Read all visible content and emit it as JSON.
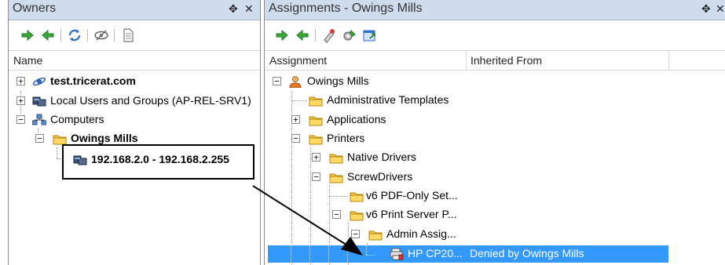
{
  "owners_pane": {
    "title": "Owners",
    "pin": "✥",
    "close": "✕",
    "column_name": "Name",
    "tree": {
      "test_tricerat": "test.tricerat.com",
      "local_users": "Local Users and Groups (AP-REL-SRV1)",
      "computers": "Computers",
      "owings_mills": "Owings Mills",
      "ip_range": "192.168.2.0 - 192.168.2.255"
    }
  },
  "assignments_pane": {
    "title": "Assignments - Owings Mills",
    "pin": "✥",
    "close": "✕",
    "columns": {
      "assignment": "Assignment",
      "inherited_from": "Inherited From"
    },
    "tree": {
      "owings_mills": "Owings Mills",
      "admin_templates": "Administrative Templates",
      "applications": "Applications",
      "printers": "Printers",
      "native_drivers": "Native Drivers",
      "screwdrivers": "ScrewDrivers",
      "v6_pdf": "v6 PDF-Only Set...",
      "v6_print_server": "v6 Print Server P...",
      "admin_assig": "Admin Assig...",
      "hp_cp20": "HP CP20...",
      "hp_cp20_inherited": "Denied by Owings Mills"
    }
  },
  "expanders": {
    "plus": "+",
    "minus": "−"
  },
  "colors": {
    "selection": "#3399ff",
    "titlebar": "#cfdcee",
    "arrow_green": "#3ca83c"
  }
}
